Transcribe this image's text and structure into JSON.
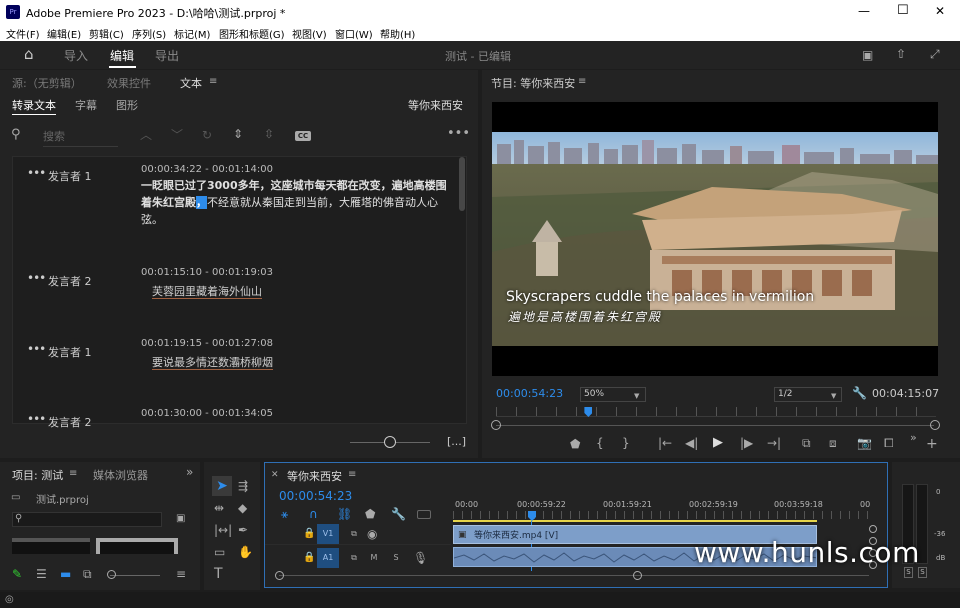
{
  "window": {
    "title": "Adobe Premiere Pro 2023 - D:\\哈哈\\测试.prproj *",
    "minimize": "—",
    "maximize": "☐",
    "close": "✕"
  },
  "menu": [
    "文件(F)",
    "编辑(E)",
    "剪辑(C)",
    "序列(S)",
    "标记(M)",
    "图形和标题(G)",
    "视图(V)",
    "窗口(W)",
    "帮助(H)"
  ],
  "workspace": {
    "tabs": [
      "导入",
      "编辑",
      "导出"
    ],
    "center_title": "测试 - 已编辑"
  },
  "source_panel": {
    "tabs": [
      "源:（无剪辑）",
      "效果控件",
      "文本"
    ],
    "subtabs": [
      "转录文本",
      "字幕",
      "图形"
    ],
    "sequence_name": "等你来西安",
    "search_placeholder": "搜索",
    "cc_label": "CC",
    "fit_label": "[...]"
  },
  "transcript": [
    {
      "speaker": "发言者 1",
      "time": "00:00:34:22 - 00:01:14:00",
      "text_line1": "一眨眼已过了3000多年，这座城市每天都在改变，遍地高楼围",
      "text_line2a": "着朱红宫殿",
      "text_line2b": "不经意就从秦国走到当前，大雁塔的佛音动人心",
      "text_line3": "弦。",
      "sep": "，"
    },
    {
      "speaker": "发言者 2",
      "time": "00:01:15:10 - 00:01:19:03",
      "text": "芙蓉园里藏着海外仙山"
    },
    {
      "speaker": "发言者 1",
      "time": "00:01:19:15 - 00:01:27:08",
      "text": "要说最多情还数灞桥柳烟"
    },
    {
      "speaker": "发言者 2",
      "time": "00:01:30:00 - 00:01:34:05",
      "text": ""
    }
  ],
  "program": {
    "title": "节目: 等你来西安",
    "subtitle_en": "Skyscrapers cuddle the palaces in vermilion",
    "subtitle_cn": "遍地是高楼围着朱红宫殿",
    "timecode": "00:00:54:23",
    "zoom": "50%",
    "quality": "1/2",
    "duration": "00:04:15:07",
    "playhead_fraction": 0.21
  },
  "project_panel": {
    "tabs": [
      "项目: 测试",
      "媒体浏览器"
    ],
    "file": "测试.prproj"
  },
  "timeline": {
    "tab": "等你来西安",
    "timecode": "00:00:54:23",
    "ruler": [
      "00:00",
      "00:00:59:22",
      "00:01:59:21",
      "00:02:59:19",
      "00:03:59:18",
      "00"
    ],
    "tracks": [
      {
        "name": "V1"
      },
      {
        "name": "A1"
      }
    ],
    "clip_label": "等你来西安.mp4 [V]"
  },
  "meters": {
    "labels": [
      "0",
      "-36",
      "dB"
    ],
    "solo": [
      "S",
      "S"
    ]
  },
  "watermark": "www.hunls.com",
  "colors": {
    "accent": "#2d8ceb",
    "clip_video": "#7d9ec9",
    "clip_audio": "#6b8bb8",
    "timeline_border": "#2f6fb5"
  }
}
